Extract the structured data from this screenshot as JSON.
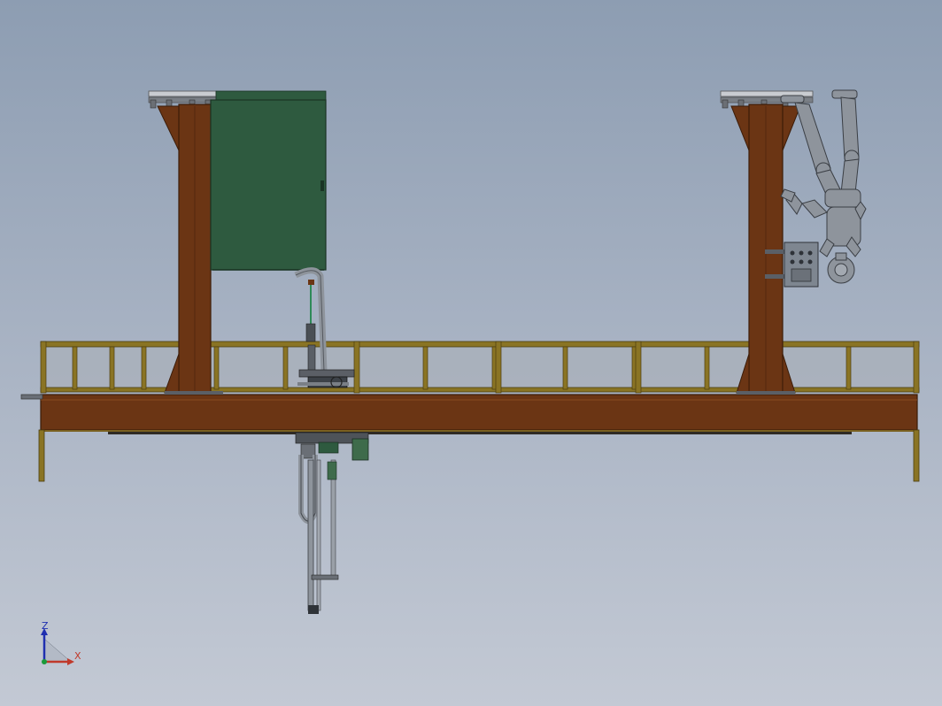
{
  "colors": {
    "background_top": "#8d9db2",
    "background_bottom": "#c3c9d4",
    "steel_rust": "#6b3514",
    "steel_edge": "#3b1c08",
    "railing_olive": "#8a7424",
    "railing_dark": "#4a3d10",
    "glass_panel": "#a9b0bb",
    "cabinet_green": "#2e5a3f",
    "machine_grey": "#8e949c",
    "axis_z": "#1f2fb0",
    "axis_x": "#c0392b"
  },
  "triad": {
    "z_label": "Z",
    "x_label": "X"
  },
  "icons": [
    "triad-icon",
    "control-box-icon",
    "human-figure-icon",
    "electrical-cabinet-icon"
  ]
}
